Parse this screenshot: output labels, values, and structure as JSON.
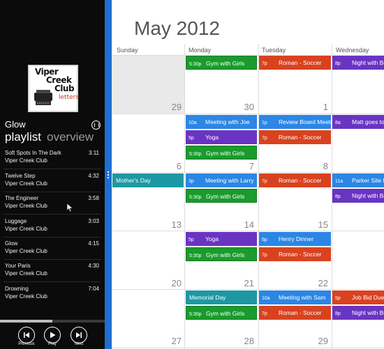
{
  "music": {
    "album_art": {
      "line1": "Viper",
      "line2": "Creek",
      "line3": "Club",
      "line4": "letters"
    },
    "now_playing": "Glow",
    "tabs": {
      "playlist": "playlist",
      "overview": "overview"
    },
    "tracks": [
      {
        "name": "Soft Spots In The Dark",
        "artist": "Viper Creek Club",
        "duration": "3:11"
      },
      {
        "name": "Twelve Step",
        "artist": "Viper Creek Club",
        "duration": "4:32"
      },
      {
        "name": "The Engineer",
        "artist": "Viper Creek Club",
        "duration": "3:58"
      },
      {
        "name": "Luggage",
        "artist": "Viper Creek Club",
        "duration": "3:03"
      },
      {
        "name": "Glow",
        "artist": "Viper Creek Club",
        "duration": "4:15"
      },
      {
        "name": "Your Paris",
        "artist": "Viper Creek Club",
        "duration": "4:30"
      },
      {
        "name": "Drowning",
        "artist": "Viper Creek Club",
        "duration": "7:04"
      }
    ],
    "progress": 0.5,
    "controls": {
      "previous": "Previous",
      "play": "Play",
      "next": "Next"
    }
  },
  "calendar": {
    "month_title": "May 2012",
    "weekdays": [
      "Sunday",
      "Monday",
      "Tuesday",
      "Wednesday"
    ],
    "day_numbers": {
      "w1": [
        "29",
        "30",
        "1"
      ],
      "w2": [
        "6",
        "7",
        "8"
      ],
      "w3": [
        "13",
        "14",
        "15"
      ],
      "w4": [
        "20",
        "21",
        "22"
      ],
      "w5": [
        "27",
        "28",
        "29"
      ]
    },
    "events": {
      "w1_mon": [
        {
          "time": "5:30p",
          "title": "Gym with Girls"
        }
      ],
      "w1_tue": [
        {
          "time": "7p",
          "title": "Roman - Soccer"
        }
      ],
      "w1_wed": [
        {
          "time": "8p",
          "title": "Night with Boys"
        }
      ],
      "w2_mon": [
        {
          "time": "10a",
          "title": "Meeting with Joe"
        },
        {
          "time": "5p",
          "title": "Yoga"
        },
        {
          "time": "5:30p",
          "title": "Gym with Girls"
        }
      ],
      "w2_tue": [
        {
          "time": "1p",
          "title": "Review Board Meeting"
        },
        {
          "time": "7p",
          "title": "Roman - Soccer"
        }
      ],
      "w2_wed": [
        {
          "time": "8a",
          "title": "Matt goes to San"
        }
      ],
      "w3_sun": [
        {
          "title": "Mother's Day"
        }
      ],
      "w3_mon": [
        {
          "time": "3p",
          "title": "Meeting with Larry"
        },
        {
          "time": "5:30p",
          "title": "Gym with Girls"
        }
      ],
      "w3_tue": [
        {
          "time": "7p",
          "title": "Roman - Soccer"
        }
      ],
      "w3_wed": [
        {
          "time": "11a",
          "title": "Parker Site Insp"
        },
        {
          "time": "8p",
          "title": "Night with Boys"
        }
      ],
      "w4_mon": [
        {
          "time": "5p",
          "title": "Yoga"
        },
        {
          "time": "5:30p",
          "title": "Gym with Girls"
        }
      ],
      "w4_tue": [
        {
          "time": "6p",
          "title": "Henry Dinner"
        },
        {
          "time": "7p",
          "title": "Roman - Soccer"
        }
      ],
      "w5_mon": [
        {
          "title": "Memorial Day"
        },
        {
          "time": "5:30p",
          "title": "Gym with Girls"
        }
      ],
      "w5_tue": [
        {
          "time": "10a",
          "title": "Meeting with Sam"
        },
        {
          "time": "7p",
          "title": "Roman - Soccer"
        }
      ],
      "w5_wed": [
        {
          "time": "5p",
          "title": "Job Bid Due!"
        },
        {
          "time": "8p",
          "title": "Night with Boys"
        }
      ]
    }
  },
  "colors": {
    "splitter": "#1e6fcf",
    "event_green": "#1a9b2d",
    "event_purple": "#6a34c3",
    "event_blue": "#2b86e4",
    "event_red": "#d9421f",
    "event_teal": "#1c98a4"
  }
}
